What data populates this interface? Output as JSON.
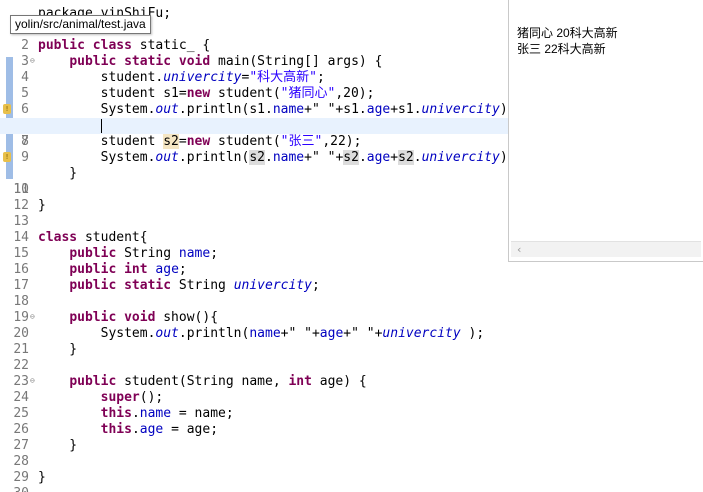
{
  "tooltip": {
    "path": "yolin/src/animal/test.java"
  },
  "editor": {
    "lines": {
      "l1": {
        "num": "1",
        "text": "package yinShiFu;"
      },
      "l2": {
        "num": "2"
      },
      "l3": {
        "num": "3",
        "kw": "public class",
        "rest": " static_ {"
      },
      "l4": {
        "num": "4",
        "pre": "    ",
        "kw": "public static void",
        "rest": " main(String[] args) {"
      },
      "l5": {
        "num": "5",
        "p1": "        student.",
        "f": "univercity",
        "p2": "=",
        "s": "\"科大高新\"",
        "p3": ";"
      },
      "l6": {
        "num": "6",
        "p1": "        student s1=",
        "kw": "new",
        "p2": " student(",
        "s": "\"猪同心\"",
        "p3": ",20);"
      },
      "l7": {
        "num": "7",
        "p1": "        System.",
        "o": "out",
        "p2": ".println(s1.",
        "f1": "name",
        "p3": "+\" \"+s1.",
        "f2": "age",
        "p4": "+s1.",
        "f3": "univercity",
        "p5": ");"
      },
      "l8": {
        "num": "8"
      },
      "l9": {
        "num": "9",
        "p1": "        student ",
        "v": "s2",
        "p2": "=",
        "kw": "new",
        "p3": " student(",
        "s": "\"张三\"",
        "p4": ",22);"
      },
      "l10": {
        "num": "10",
        "p1": "        System.",
        "o": "out",
        "p2": ".println(",
        "v1": "s2",
        "p3": ".",
        "f1": "name",
        "p4": "+\" \"+",
        "v2": "s2",
        "p5": ".",
        "f2": "age",
        "p6": "+",
        "v3": "s2",
        "p7": ".",
        "f3": "univercity",
        "p8": ");"
      },
      "l11": {
        "num": "11",
        "text": "    }"
      },
      "l12": {
        "num": "12"
      },
      "l13": {
        "num": "13",
        "text": "}"
      },
      "l14": {
        "num": "14"
      },
      "l15": {
        "num": "15",
        "kw": "class",
        "rest": " student{"
      },
      "l16": {
        "num": "16",
        "pre": "    ",
        "kw": "public",
        "mid": " String ",
        "f": "name",
        "rest": ";"
      },
      "l17": {
        "num": "17",
        "pre": "    ",
        "kw": "public int",
        "mid": " ",
        "f": "age",
        "rest": ";"
      },
      "l18": {
        "num": "18",
        "pre": "    ",
        "kw": "public static",
        "mid": " String ",
        "f": "univercity",
        "rest": ";"
      },
      "l19": {
        "num": "19"
      },
      "l20": {
        "num": "20",
        "pre": "    ",
        "kw": "public void",
        "rest": " show(){"
      },
      "l21": {
        "num": "21",
        "p1": "        System.",
        "o": "out",
        "p2": ".println(",
        "f1": "name",
        "p3": "+\" \"+",
        "f2": "age",
        "p4": "+\" \"+",
        "f3": "univercity",
        "p5": " );"
      },
      "l22": {
        "num": "22",
        "text": "    }"
      },
      "l23": {
        "num": "23"
      },
      "l24": {
        "num": "24",
        "pre": "    ",
        "kw": "public",
        "mid": " student(String name, ",
        "kw2": "int",
        "rest": " age) {"
      },
      "l25": {
        "num": "25",
        "pre": "        ",
        "kw": "super",
        "rest": "();"
      },
      "l26": {
        "num": "26",
        "pre": "        ",
        "kw": "this",
        "p1": ".",
        "f": "name",
        "rest": " = name;"
      },
      "l27": {
        "num": "27",
        "pre": "        ",
        "kw": "this",
        "p1": ".",
        "f": "age",
        "rest": " = age;"
      },
      "l28": {
        "num": "28",
        "text": "    }"
      },
      "l29": {
        "num": "29"
      },
      "l30": {
        "num": "30",
        "text": "}"
      }
    },
    "colors": {
      "keyword": "#7f0055",
      "string": "#2a00ff",
      "field": "#0000c0",
      "current_line": "#e8f2fe"
    }
  },
  "console": {
    "output": [
      "猪同心 20科大高新",
      "张三 22科大高新"
    ]
  },
  "icons": [
    "warning-icon",
    "fold-icon",
    "scroll-left-icon"
  ]
}
